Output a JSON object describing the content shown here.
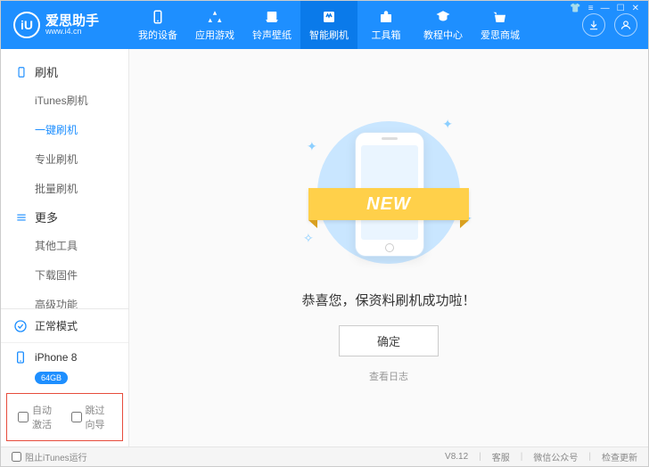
{
  "header": {
    "logo_text": "iU",
    "title": "爱思助手",
    "subtitle": "www.i4.cn",
    "nav": [
      {
        "label": "我的设备"
      },
      {
        "label": "应用游戏"
      },
      {
        "label": "铃声壁纸"
      },
      {
        "label": "智能刷机"
      },
      {
        "label": "工具箱"
      },
      {
        "label": "教程中心"
      },
      {
        "label": "爱思商城"
      }
    ],
    "active_nav_index": 3
  },
  "sidebar": {
    "group1": {
      "title": "刷机",
      "items": [
        "iTunes刷机",
        "一键刷机",
        "专业刷机",
        "批量刷机"
      ],
      "active_index": 1
    },
    "group2": {
      "title": "更多",
      "items": [
        "其他工具",
        "下载固件",
        "高级功能"
      ]
    },
    "mode_label": "正常模式",
    "device_name": "iPhone 8",
    "device_tag": "64GB",
    "check_auto": "自动激活",
    "check_skip": "跳过向导"
  },
  "main": {
    "ribbon": "NEW",
    "message": "恭喜您，保资料刷机成功啦！",
    "ok_button": "确定",
    "log_link": "查看日志"
  },
  "footer": {
    "block_itunes": "阻止iTunes运行",
    "version": "V8.12",
    "links": [
      "客服",
      "微信公众号",
      "检查更新"
    ]
  }
}
